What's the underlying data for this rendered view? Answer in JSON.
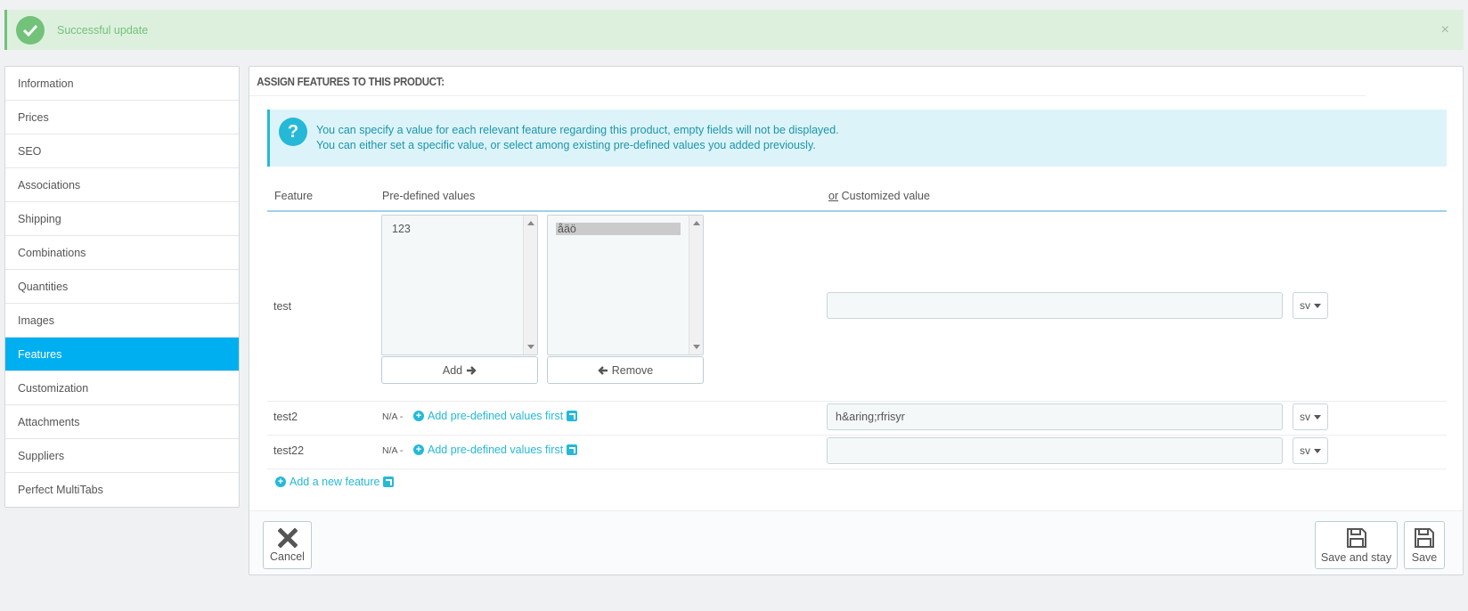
{
  "notification": {
    "message": "Successful update",
    "close": "×"
  },
  "sidebar": {
    "items": [
      {
        "label": "Information"
      },
      {
        "label": "Prices"
      },
      {
        "label": "SEO"
      },
      {
        "label": "Associations"
      },
      {
        "label": "Shipping"
      },
      {
        "label": "Combinations"
      },
      {
        "label": "Quantities"
      },
      {
        "label": "Images"
      },
      {
        "label": "Features",
        "active": true
      },
      {
        "label": "Customization"
      },
      {
        "label": "Attachments"
      },
      {
        "label": "Suppliers"
      },
      {
        "label": "Perfect MultiTabs"
      }
    ]
  },
  "panel": {
    "title": "ASSIGN FEATURES TO THIS PRODUCT:",
    "help_icon": "?",
    "info_line1": "You can specify a value for each relevant feature regarding this product, empty fields will not be displayed.",
    "info_line2": "You can either set a specific value, or select among existing pre-defined values you added previously.",
    "table": {
      "col_feature": "Feature",
      "col_predefined": "Pre-defined values",
      "col_custom_or": "or",
      "col_custom": "Customized value"
    },
    "rows": [
      {
        "feature": "test",
        "available_values": [
          "123"
        ],
        "selected_values": [
          "åäö"
        ],
        "add_label": "Add",
        "remove_label": "Remove",
        "custom_value": "",
        "lang": "sv"
      },
      {
        "feature": "test2",
        "na": "N/A -",
        "add_predefined": "Add pre-defined values first",
        "custom_value": "h&aring;rfrisyr",
        "lang": "sv"
      },
      {
        "feature": "test22",
        "na": "N/A -",
        "add_predefined": "Add pre-defined values first",
        "custom_value": "",
        "lang": "sv"
      }
    ],
    "add_new_feature": "Add a new feature"
  },
  "footer": {
    "cancel": "Cancel",
    "save_and_stay": "Save and stay",
    "save": "Save"
  },
  "colors": {
    "accent": "#00aff0",
    "success": "#72c279",
    "info": "#25b9d7"
  }
}
